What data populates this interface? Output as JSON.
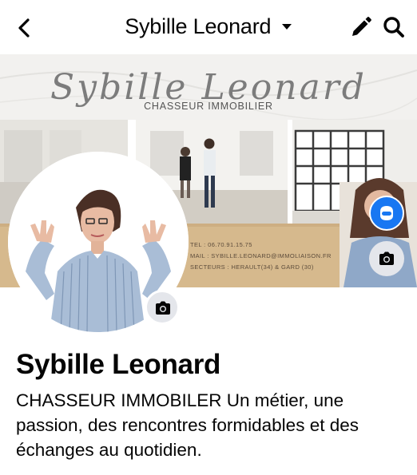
{
  "header": {
    "title": "Sybille Leonard",
    "back_icon": "chevron-left-icon",
    "caret_icon": "caret-down-icon",
    "edit_icon": "pencil-icon",
    "search_icon": "search-icon"
  },
  "cover": {
    "logo_name": "Sybille Leonard",
    "logo_subtitle": "CHASSEUR IMMOBILIER",
    "info_lines": [
      "TEL : 06.70.91.15.75",
      "MAIL : SYBILLE.LEONARD@IMMOLIAISON.FR",
      "SECTEURS : HERAULT(34) & GARD (30)"
    ],
    "camera_icon": "camera-icon",
    "badge_icon": "avatar-icon"
  },
  "profile": {
    "name": "Sybille Leonard",
    "bio": "CHASSEUR IMMOBILER Un métier, une passion, des rencontres formidables et des échanges au quotidien.",
    "camera_icon": "camera-icon"
  },
  "colors": {
    "accent": "#1877f2",
    "text": "#050505",
    "icon_bg": "#e4e6eb",
    "cover_gold": "#d6b98d"
  }
}
